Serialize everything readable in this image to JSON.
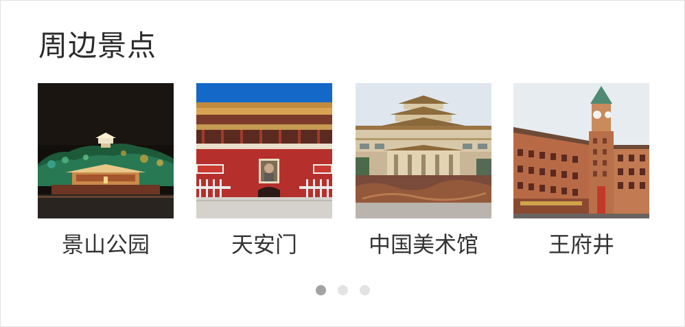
{
  "section": {
    "title": "周边景点"
  },
  "spots": [
    {
      "label": "景山公园"
    },
    {
      "label": "天安门"
    },
    {
      "label": "中国美术馆"
    },
    {
      "label": "王府井"
    }
  ],
  "pagination": {
    "total": 3,
    "active_index": 0
  },
  "colors": {
    "title": "#2b2b2b",
    "label": "#333333",
    "dot_active": "#a3a3a3",
    "dot_inactive": "#e3e3e3",
    "border": "#e2e2e2"
  }
}
